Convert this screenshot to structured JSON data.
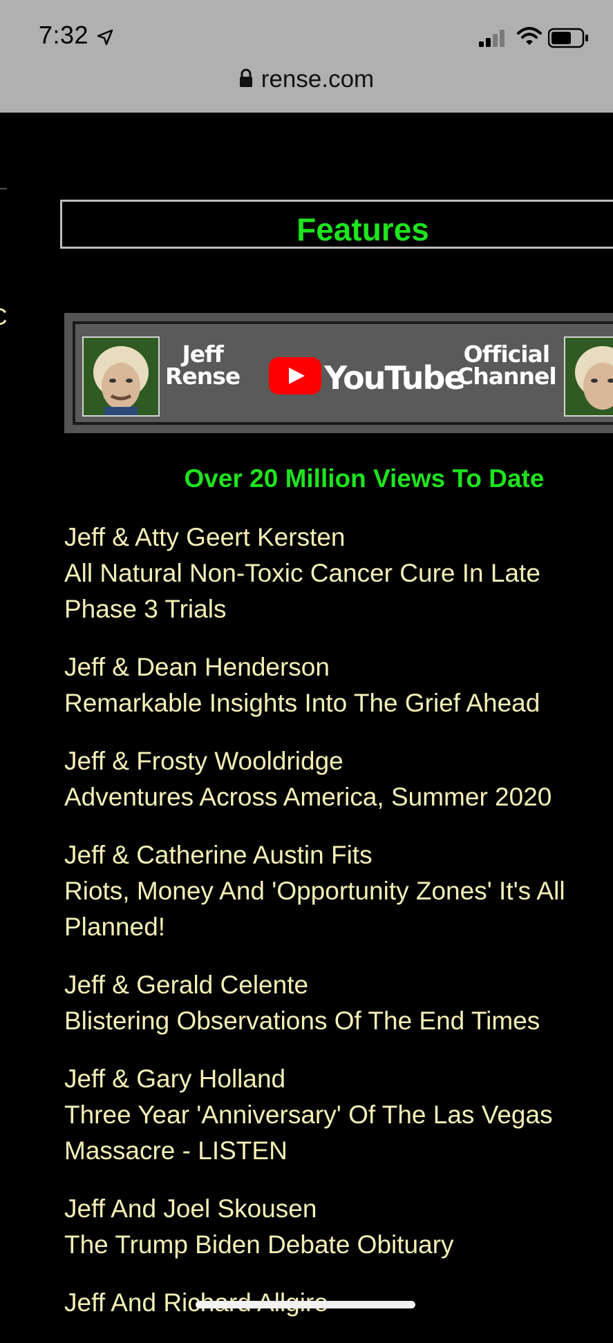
{
  "status_bar": {
    "time": "7:32"
  },
  "browser": {
    "url": "rense.com"
  },
  "page": {
    "side_fragment": "C",
    "features_title": "Features",
    "banner": {
      "left_text_1": "Jeff",
      "left_text_2": "Rense",
      "youtube_word": "YouTube",
      "right_text_1": "Official",
      "right_text_2": "Channel"
    },
    "views_text": "Over 20 Million Views To Date",
    "items": [
      {
        "title": "Jeff & Atty Geert Kersten",
        "subtitle_1": "All Natural Non-Toxic Cancer Cure In Late",
        "subtitle_2": "Phase 3 Trials"
      },
      {
        "title": "Jeff & Dean Henderson",
        "subtitle_1": "Remarkable Insights Into The Grief Ahead",
        "subtitle_2": ""
      },
      {
        "title": "Jeff & Frosty Wooldridge",
        "subtitle_1": "Adventures Across America, Summer 2020",
        "subtitle_2": ""
      },
      {
        "title": "Jeff & Catherine Austin Fits",
        "subtitle_1": "Riots, Money And 'Opportunity Zones' It's All",
        "subtitle_2": "Planned!"
      },
      {
        "title": "Jeff & Gerald Celente",
        "subtitle_1": "Blistering Observations Of The End Times",
        "subtitle_2": ""
      },
      {
        "title": "Jeff & Gary Holland",
        "subtitle_1": "Three Year 'Anniversary' Of The Las Vegas",
        "subtitle_2": "Massacre - LISTEN"
      },
      {
        "title": "Jeff And Joel Skousen",
        "subtitle_1": "The Trump Biden Debate Obituary",
        "subtitle_2": ""
      },
      {
        "title": "Jeff And Richard Allgire",
        "subtitle_1": "",
        "subtitle_2": ""
      }
    ]
  },
  "colors": {
    "background": "#000000",
    "accent_green": "#1fe31f",
    "link_text": "#f6f0b8",
    "chrome": "#b0b0b0"
  }
}
